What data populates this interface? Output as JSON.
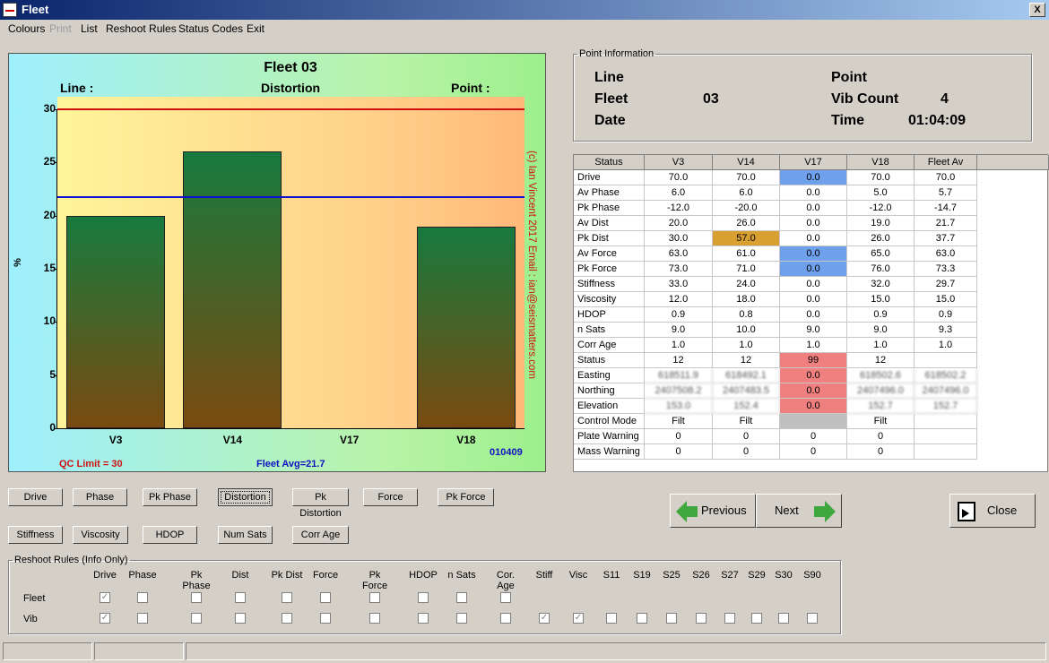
{
  "window": {
    "title": "Fleet",
    "close_glyph": "X"
  },
  "menu": [
    "Colours",
    "Print",
    "List",
    "Reshoot Rules",
    "Status Codes",
    "Exit"
  ],
  "chart_data": {
    "type": "bar",
    "title": "Fleet 03",
    "subtitle": "Distortion",
    "header_left": "Line :",
    "header_right": "Point :",
    "ylabel": "%",
    "categories": [
      "V3",
      "V14",
      "V17",
      "V18"
    ],
    "values": [
      20,
      26,
      0,
      19
    ],
    "ylim": [
      0,
      30
    ],
    "yticks": [
      "0",
      "5",
      "10",
      "15",
      "20",
      "25",
      "30"
    ],
    "qc_limit": 30,
    "fleet_avg": 21.7,
    "qc_label": "QC Limit = 30",
    "avg_label": "Fleet Avg=21.7",
    "point_id": "010409",
    "copyright": "(c) Ian Vincent 2017  Email : ian@seismatters.com",
    "colors": {
      "qc_line": "#d01010",
      "avg_line": "#1010d0",
      "bar_top": "#177a3e",
      "bar_bottom": "#7a4a10"
    }
  },
  "point_info": {
    "legend": "Point Information",
    "labels": {
      "line": "Line",
      "fleet": "Fleet",
      "date": "Date",
      "point": "Point",
      "vib_count": "Vib Count",
      "time": "Time"
    },
    "fleet": "03",
    "vib_count": "4",
    "time": "01:04:09"
  },
  "grid": {
    "headers": [
      "Status",
      "V3",
      "V14",
      "V17",
      "V18",
      "Fleet Av"
    ],
    "rows": [
      {
        "label": "Drive",
        "cells": [
          "70.0",
          "70.0",
          "0.0",
          "70.0",
          "70.0"
        ],
        "hl": [
          null,
          null,
          "#6ea0ec",
          null,
          null
        ]
      },
      {
        "label": "Av Phase",
        "cells": [
          "6.0",
          "6.0",
          "0.0",
          "5.0",
          "5.7"
        ]
      },
      {
        "label": "Pk Phase",
        "cells": [
          "-12.0",
          "-20.0",
          "0.0",
          "-12.0",
          "-14.7"
        ]
      },
      {
        "label": "Av Dist",
        "cells": [
          "20.0",
          "26.0",
          "0.0",
          "19.0",
          "21.7"
        ]
      },
      {
        "label": "Pk Dist",
        "cells": [
          "30.0",
          "57.0",
          "0.0",
          "26.0",
          "37.7"
        ],
        "hl": [
          null,
          "#d8a030",
          null,
          null,
          null
        ]
      },
      {
        "label": "Av Force",
        "cells": [
          "63.0",
          "61.0",
          "0.0",
          "65.0",
          "63.0"
        ],
        "hl": [
          null,
          null,
          "#6ea0ec",
          null,
          null
        ]
      },
      {
        "label": "Pk Force",
        "cells": [
          "73.0",
          "71.0",
          "0.0",
          "76.0",
          "73.3"
        ],
        "hl": [
          null,
          null,
          "#6ea0ec",
          null,
          null
        ]
      },
      {
        "label": "Stiffness",
        "cells": [
          "33.0",
          "24.0",
          "0.0",
          "32.0",
          "29.7"
        ]
      },
      {
        "label": "Viscosity",
        "cells": [
          "12.0",
          "18.0",
          "0.0",
          "15.0",
          "15.0"
        ]
      },
      {
        "label": "HDOP",
        "cells": [
          "0.9",
          "0.8",
          "0.0",
          "0.9",
          "0.9"
        ]
      },
      {
        "label": "n Sats",
        "cells": [
          "9.0",
          "10.0",
          "9.0",
          "9.0",
          "9.3"
        ]
      },
      {
        "label": "Corr Age",
        "cells": [
          "1.0",
          "1.0",
          "1.0",
          "1.0",
          "1.0"
        ]
      },
      {
        "label": "Status",
        "cells": [
          "12",
          "12",
          "99",
          "12",
          ""
        ],
        "hl": [
          null,
          null,
          "#f08080",
          null,
          null
        ]
      },
      {
        "label": "Easting",
        "cells": [
          "618511.9",
          "618492.1",
          "0.0",
          "618502.6",
          "618502.2"
        ],
        "hl": [
          null,
          null,
          "#f08080",
          null,
          null
        ],
        "blur": [
          true,
          true,
          false,
          true,
          true
        ]
      },
      {
        "label": "Northing",
        "cells": [
          "2407508.2",
          "2407483.5",
          "0.0",
          "2407496.0",
          "2407496.0"
        ],
        "hl": [
          null,
          null,
          "#f08080",
          null,
          null
        ],
        "blur": [
          true,
          true,
          false,
          true,
          true
        ]
      },
      {
        "label": "Elevation",
        "cells": [
          "153.0",
          "152.4",
          "0.0",
          "152.7",
          "152.7"
        ],
        "hl": [
          null,
          null,
          "#f08080",
          null,
          null
        ],
        "blur": [
          true,
          true,
          false,
          true,
          true
        ]
      },
      {
        "label": "Control Mode",
        "cells": [
          "Filt",
          "Filt",
          "",
          "Filt",
          ""
        ],
        "hl": [
          null,
          null,
          "#c0c0c0",
          null,
          null
        ]
      },
      {
        "label": "Plate Warning",
        "cells": [
          "0",
          "0",
          "0",
          "0",
          ""
        ]
      },
      {
        "label": "Mass Warning",
        "cells": [
          "0",
          "0",
          "0",
          "0",
          ""
        ]
      }
    ]
  },
  "chart_buttons_row1": [
    "Drive",
    "Phase",
    "Pk Phase",
    "Distortion",
    "Pk Distortion",
    "Force",
    "Pk Force"
  ],
  "chart_buttons_row2": [
    "Stiffness",
    "Viscosity",
    "HDOP",
    "Num Sats",
    "Corr Age"
  ],
  "nav": {
    "previous": "Previous",
    "next": "Next",
    "close": "Close"
  },
  "reshoot": {
    "legend": "Reshoot Rules (Info Only)",
    "columns": [
      "Drive",
      "Phase",
      "Pk Phase",
      "Dist",
      "Pk Dist",
      "Force",
      "Pk Force",
      "HDOP",
      "n Sats",
      "Cor. Age",
      "Stiff",
      "Visc",
      "S11",
      "S19",
      "S25",
      "S26",
      "S27",
      "S29",
      "S30",
      "S90"
    ],
    "rows": [
      {
        "label": "Fleet",
        "checked": [
          true,
          false,
          false,
          false,
          false,
          false,
          false,
          false,
          false,
          false,
          null,
          null,
          null,
          null,
          null,
          null,
          null,
          null,
          null,
          null
        ]
      },
      {
        "label": "Vib",
        "checked": [
          true,
          false,
          false,
          false,
          false,
          false,
          false,
          false,
          false,
          false,
          true,
          true,
          false,
          false,
          false,
          false,
          false,
          false,
          false,
          false
        ]
      }
    ]
  }
}
